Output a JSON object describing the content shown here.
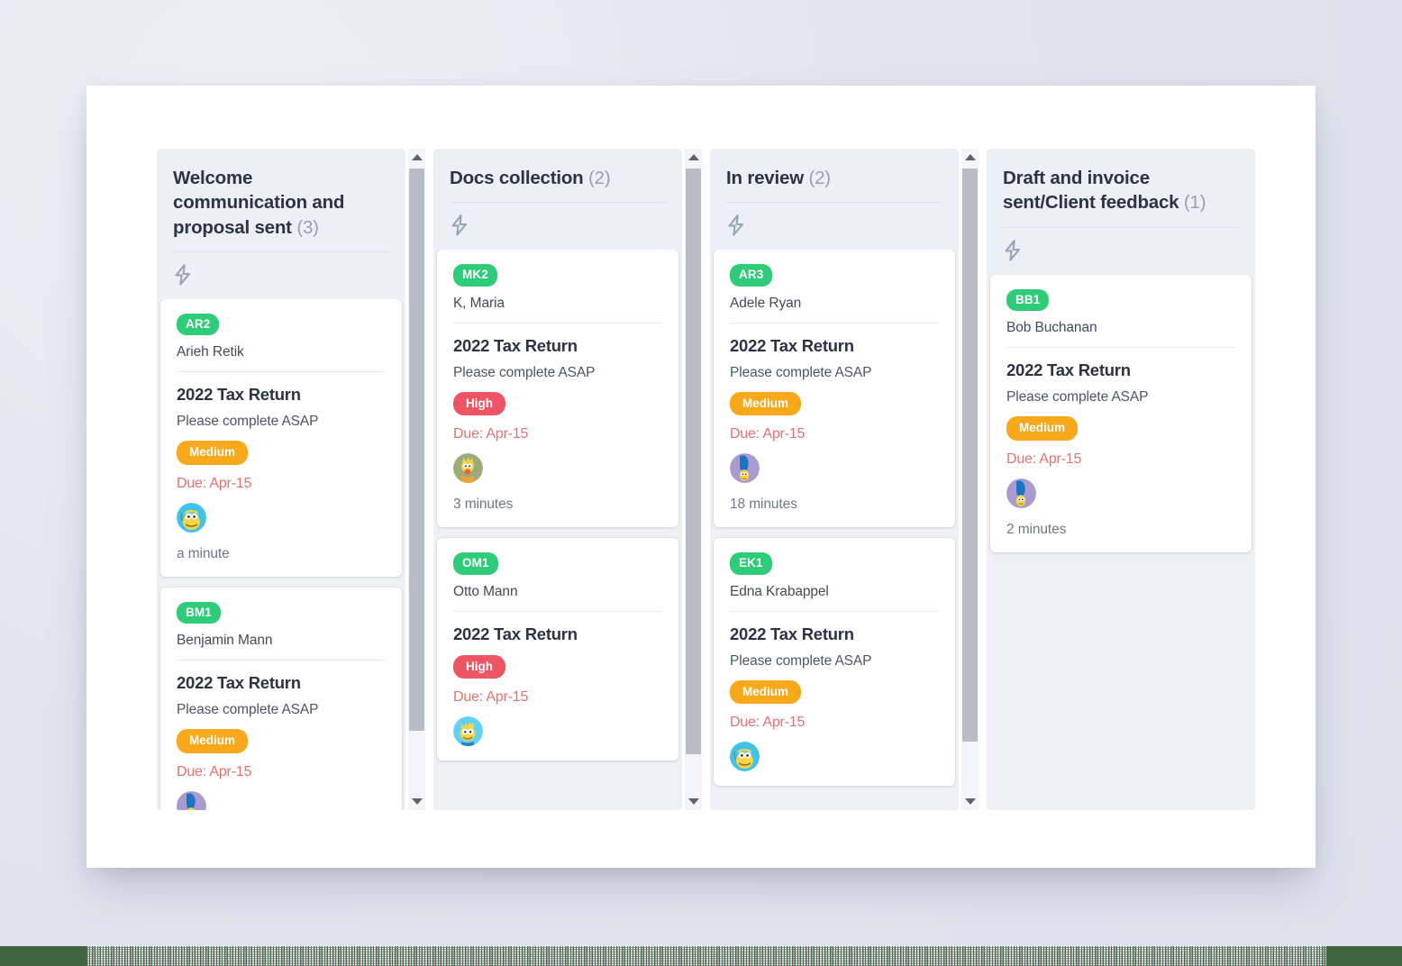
{
  "board": {
    "columns": [
      {
        "title": "Welcome communication and proposal sent",
        "count": "(3)",
        "action_icon": "lightning-bolt-icon",
        "has_scrollbar": true,
        "cards": [
          {
            "id_badge": "AR2",
            "client": "Arieh Retik",
            "title": "2022 Tax Return",
            "description": "Please complete ASAP",
            "priority": "Medium",
            "priority_level": "medium",
            "due": "Due: Apr-15",
            "avatar": "homer-avatar",
            "elapsed": "a minute"
          },
          {
            "id_badge": "BM1",
            "client": "Benjamin Mann",
            "title": "2022 Tax Return",
            "description": "Please complete ASAP",
            "priority": "Medium",
            "priority_level": "medium",
            "due": "Due: Apr-15",
            "avatar": "marge-avatar",
            "elapsed": ""
          }
        ]
      },
      {
        "title": "Docs collection",
        "count": "(2)",
        "action_icon": "lightning-bolt-icon",
        "has_scrollbar": true,
        "cards": [
          {
            "id_badge": "MK2",
            "client": "K, Maria",
            "title": "2022 Tax Return",
            "description": "Please complete ASAP",
            "priority": "High",
            "priority_level": "high",
            "due": "Due: Apr-15",
            "avatar": "maggie-avatar",
            "elapsed": "3 minutes"
          },
          {
            "id_badge": "OM1",
            "client": "Otto Mann",
            "title": "2022 Tax Return",
            "description": "",
            "priority": "High",
            "priority_level": "high",
            "due": "Due: Apr-15",
            "avatar": "bart-avatar",
            "elapsed": ""
          }
        ]
      },
      {
        "title": "In review",
        "count": "(2)",
        "action_icon": "lightning-bolt-icon",
        "has_scrollbar": true,
        "cards": [
          {
            "id_badge": "AR3",
            "client": "Adele Ryan",
            "title": "2022 Tax Return",
            "description": "Please complete ASAP",
            "priority": "Medium",
            "priority_level": "medium",
            "due": "Due: Apr-15",
            "avatar": "marge-avatar",
            "elapsed": "18 minutes"
          },
          {
            "id_badge": "EK1",
            "client": "Edna Krabappel",
            "title": "2022 Tax Return",
            "description": "Please complete ASAP",
            "priority": "Medium",
            "priority_level": "medium",
            "due": "Due: Apr-15",
            "avatar": "homer-avatar",
            "elapsed": ""
          }
        ]
      },
      {
        "title": "Draft and invoice sent/Client feedback",
        "count": "(1)",
        "action_icon": "lightning-bolt-icon",
        "has_scrollbar": false,
        "cards": [
          {
            "id_badge": "BB1",
            "client": "Bob Buchanan",
            "title": "2022 Tax Return",
            "description": "Please complete ASAP",
            "priority": "Medium",
            "priority_level": "medium",
            "due": "Due: Apr-15",
            "avatar": "marge-avatar",
            "elapsed": "2 minutes"
          }
        ]
      }
    ]
  },
  "colors": {
    "page_background": "#e3e6ee",
    "panel_background": "#ffffff",
    "column_background": "#eef0f6",
    "id_badge": "#2ecc78",
    "priority_medium": "#f7a81b",
    "priority_high": "#ed5565",
    "due_text": "#e8716e",
    "title_text": "#2b3445",
    "scrollbar_thumb": "#b9bcc4"
  }
}
